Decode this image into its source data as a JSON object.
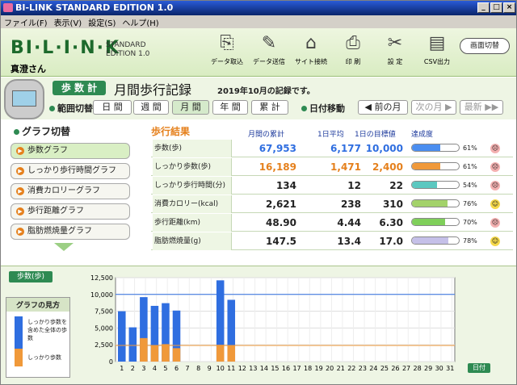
{
  "title": "BI-LINK STANDARD EDITION 1.0",
  "menu": [
    "ファイル(F)",
    "表示(V)",
    "設定(S)",
    "ヘルプ(H)"
  ],
  "logo": "BI·L·I·N·K",
  "logo_sub": "STANDARD EDITION 1.0",
  "user": "真澄さん",
  "tools": [
    {
      "label": "データ取込",
      "icon": "import-icon"
    },
    {
      "label": "データ送信",
      "icon": "send-icon"
    },
    {
      "label": "サイト接続",
      "icon": "site-icon"
    },
    {
      "label": "印 刷",
      "icon": "print-icon"
    },
    {
      "label": "設 定",
      "icon": "settings-icon"
    },
    {
      "label": "CSV出力",
      "icon": "csv-icon"
    }
  ],
  "screen_switch": "画面切替",
  "mode": "歩 数 計",
  "page_title": "月間歩行記録",
  "record_label": "2019年10月の記録です。",
  "range_label": "範囲切替",
  "ranges": [
    "日 間",
    "週 間",
    "月 間",
    "年 間",
    "累 計"
  ],
  "date_move_label": "日付移動",
  "date_buttons": [
    "◀ 前の月",
    "次の月 ▶",
    "最新 ▶▶"
  ],
  "graph_switch": "グラフ切替",
  "graphs": [
    "歩数グラフ",
    "しっかり歩行時間グラフ",
    "消費カロリーグラフ",
    "歩行距離グラフ",
    "脂肪燃焼量グラフ"
  ],
  "results_title": "歩行結果",
  "col_headers": [
    "月間の累計",
    "1日平均",
    "1日の目標値",
    "達成度"
  ],
  "rows": [
    {
      "label": "歩数(歩)",
      "total": "67,953",
      "avg": "6,177",
      "goal": "10,000",
      "pct": "61%",
      "fill": 61,
      "color": "#2f6ee0",
      "bar": "#4b8ef0",
      "face": "☹"
    },
    {
      "label": "しっかり歩数(歩)",
      "total": "16,189",
      "avg": "1,471",
      "goal": "2,400",
      "pct": "61%",
      "fill": 61,
      "color": "#e5801c",
      "bar": "#f0993a",
      "face": "☹"
    },
    {
      "label": "しっかり歩行時間(分)",
      "total": "134",
      "avg": "12",
      "goal": "22",
      "pct": "54%",
      "fill": 54,
      "color": "#222",
      "bar": "#5cc8c0",
      "face": "☹"
    },
    {
      "label": "消費カロリー(kcal)",
      "total": "2,621",
      "avg": "238",
      "goal": "310",
      "pct": "76%",
      "fill": 76,
      "color": "#222",
      "bar": "#a3d26a",
      "face": "☺"
    },
    {
      "label": "歩行距離(km)",
      "total": "48.90",
      "avg": "4.44",
      "goal": "6.30",
      "pct": "70%",
      "fill": 70,
      "color": "#222",
      "bar": "#7fcf5a",
      "face": "☹"
    },
    {
      "label": "脂肪燃焼量(g)",
      "total": "147.5",
      "avg": "13.4",
      "goal": "17.0",
      "pct": "78%",
      "fill": 78,
      "color": "#222",
      "bar": "#c5c0e8",
      "face": "☺"
    }
  ],
  "chart_tag": "歩数(歩)",
  "guide_title": "グラフの見方",
  "guide_text1": "しっかり歩数を含めた全体の歩数",
  "guide_text2": "しっかり歩数",
  "day_tag": "日付",
  "chart_data": {
    "type": "bar",
    "x": [
      1,
      2,
      3,
      4,
      5,
      6,
      7,
      8,
      9,
      10,
      11,
      12,
      13,
      14,
      15,
      16,
      17,
      18,
      19,
      20,
      21,
      22,
      23,
      24,
      25,
      26,
      27,
      28,
      29,
      30,
      31
    ],
    "series": [
      {
        "name": "全体の歩数",
        "values": [
          7500,
          5100,
          9600,
          8300,
          8700,
          7600,
          0,
          0,
          0,
          12100,
          9200,
          0,
          0,
          0,
          0,
          0,
          0,
          0,
          0,
          0,
          0,
          0,
          0,
          0,
          0,
          0,
          0,
          0,
          0,
          0,
          0
        ]
      },
      {
        "name": "しっかり歩数",
        "values": [
          0,
          0,
          3500,
          2400,
          2600,
          2000,
          0,
          0,
          0,
          2500,
          2400,
          0,
          0,
          0,
          0,
          0,
          0,
          0,
          0,
          0,
          0,
          0,
          0,
          0,
          0,
          0,
          0,
          0,
          0,
          0,
          0
        ]
      }
    ],
    "ylim": [
      0,
      12500
    ],
    "yticks": [
      "0",
      "2,500",
      "5,000",
      "7,500",
      "10,000",
      "12,500"
    ],
    "goal_line": 10000,
    "strong_goal_line": 2400
  }
}
